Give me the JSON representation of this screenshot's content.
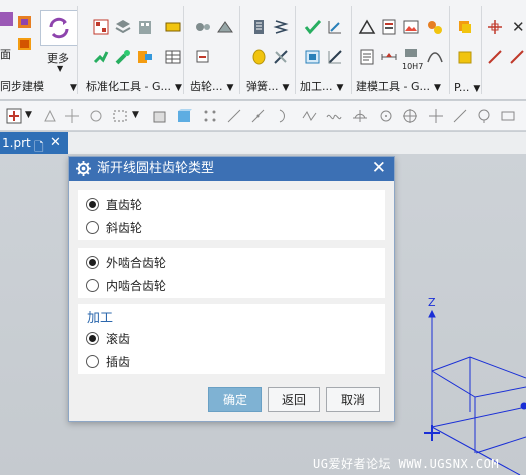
{
  "ribbon": {
    "groups": [
      {
        "label": "同步建模"
      },
      {
        "label": "标准化工具 - G..."
      },
      {
        "label": "齿轮..."
      },
      {
        "label": "弹簧..."
      },
      {
        "label": "加工..."
      },
      {
        "label": "建模工具 - G..."
      },
      {
        "label": "P..."
      }
    ],
    "more_label": "更多",
    "partial_label": "面",
    "tool_caption": "10H7"
  },
  "tabbar": {
    "file_tab": "1.prt"
  },
  "dialog": {
    "title": "渐开线圆柱齿轮类型",
    "group1": [
      {
        "label": "直齿轮",
        "selected": true
      },
      {
        "label": "斜齿轮",
        "selected": false
      }
    ],
    "group2": [
      {
        "label": "外啮合齿轮",
        "selected": true
      },
      {
        "label": "内啮合齿轮",
        "selected": false
      }
    ],
    "machining": {
      "title": "加工",
      "options": [
        {
          "label": "滚齿",
          "selected": true
        },
        {
          "label": "插齿",
          "selected": false
        }
      ]
    },
    "buttons": {
      "ok": "确定",
      "back": "返回",
      "cancel": "取消"
    }
  },
  "viewport": {
    "axis_label": "Z"
  },
  "watermark": "UG爱好者论坛 WWW.UGSNX.COM",
  "colors": {
    "title_bar": "#3c70b4",
    "file_tab": "#2f6fb6",
    "accent_text": "#2d68ad",
    "primary_button": "#7fb2d3",
    "triad_blue": "#1a2fd6"
  }
}
